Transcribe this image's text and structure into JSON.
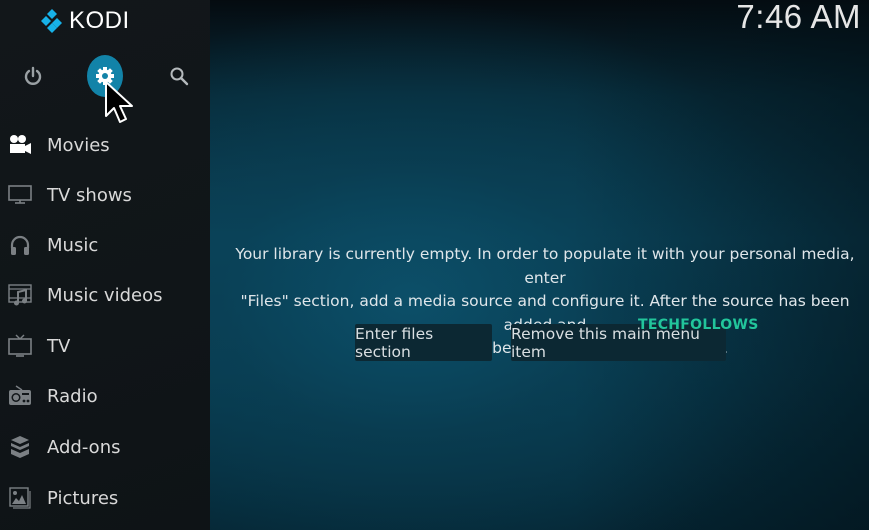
{
  "app": {
    "name": "KODI",
    "brand_color": "#1283a8"
  },
  "header": {
    "clock": "7:46 AM"
  },
  "top_controls": [
    {
      "id": "power",
      "icon": "power-icon"
    },
    {
      "id": "settings",
      "icon": "gear-icon",
      "active": true
    },
    {
      "id": "search",
      "icon": "search-icon"
    }
  ],
  "sidebar": {
    "items": [
      {
        "label": "Movies",
        "icon": "movie-camera-icon",
        "active": true
      },
      {
        "label": "TV shows",
        "icon": "monitor-icon"
      },
      {
        "label": "Music",
        "icon": "headphones-icon"
      },
      {
        "label": "Music videos",
        "icon": "music-video-icon"
      },
      {
        "label": "TV",
        "icon": "tv-icon"
      },
      {
        "label": "Radio",
        "icon": "radio-icon"
      },
      {
        "label": "Add-ons",
        "icon": "addons-box-icon"
      },
      {
        "label": "Pictures",
        "icon": "pictures-icon"
      }
    ]
  },
  "main": {
    "message_lines": [
      "Your library is currently empty. In order to populate it with your personal media, enter",
      "\"Files\" section, add a media source and configure it. After the source has been added and",
      "indexed you will be able to browse your library."
    ],
    "buttons": {
      "enter_files": "Enter files section",
      "remove_item": "Remove this main menu item"
    }
  },
  "watermark": "TECHFOLLOWS"
}
